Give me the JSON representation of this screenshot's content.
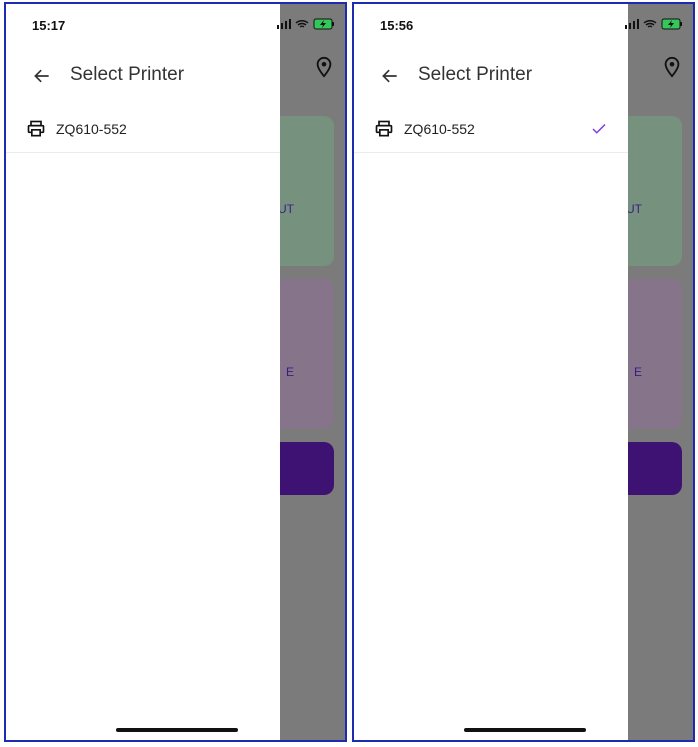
{
  "screens": [
    {
      "time": "15:17",
      "title": "Select Printer",
      "printer": {
        "name": "ZQ610-552",
        "selected": false
      },
      "bg_card_green_text": "UT",
      "bg_card_purple_text": "E"
    },
    {
      "time": "15:56",
      "title": "Select Printer",
      "printer": {
        "name": "ZQ610-552",
        "selected": true
      },
      "bg_card_green_text": "UT",
      "bg_card_purple_text": "E"
    }
  ],
  "colors": {
    "accent": "#7b3fe4",
    "overlay": "#7b7b7b",
    "frame": "#1c2bb0"
  },
  "icons": [
    "back-arrow-icon",
    "printer-icon",
    "check-icon",
    "location-pin-icon",
    "signal-icon",
    "wifi-icon",
    "battery-icon"
  ]
}
